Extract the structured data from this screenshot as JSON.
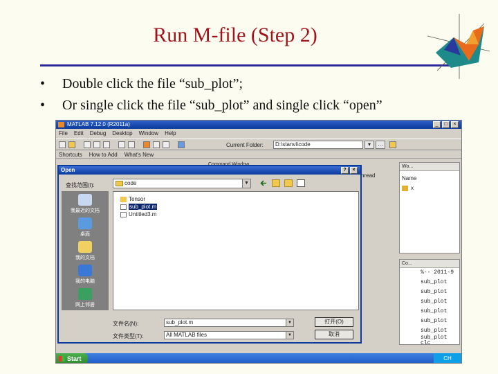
{
  "slide": {
    "title": "Run M-file (Step 2)",
    "bullets": [
      "Double click the file “sub_plot”;",
      "Or single click the file “sub_plot” and single click “open”"
    ],
    "bullet_mark": "•"
  },
  "matlab": {
    "window_title": "MATLAB 7.12.0 (R2011a)",
    "menu": [
      "File",
      "Edit",
      "Debug",
      "Desktop",
      "Window",
      "Help"
    ],
    "current_folder_label": "Current Folder:",
    "current_folder_value": "D:\\stanvi\\code",
    "shortcuts": [
      "Shortcuts",
      "How to Add",
      "What's New"
    ],
    "command_window_label": "Command Window",
    "command_text": "cnread",
    "workspace_label": "Wo...",
    "workspace_name_col": "Name",
    "workspace_var": "x",
    "history_label": "Co...",
    "history_items": [
      "%-- 2011-9",
      "sub_plot",
      "sub_plot",
      "sub_plot",
      "sub_plot",
      "sub_plot",
      "sub_plot",
      "sub_plot",
      "clc"
    ],
    "taskbar_start": "Start",
    "tray_text": "CH"
  },
  "dialog": {
    "title": "Open",
    "look_in_label": "查找范围(I):",
    "look_in_value": "code",
    "places": [
      "我最近的文档",
      "桌面",
      "我的文档",
      "我的电脑",
      "网上邻居"
    ],
    "files": [
      {
        "name": "Tensor",
        "kind": "folder",
        "selected": false
      },
      {
        "name": "sub_plot.m",
        "kind": "mfile",
        "selected": true
      },
      {
        "name": "Untitled3.m",
        "kind": "mfile",
        "selected": false
      }
    ],
    "filename_label": "文件名(N):",
    "filename_value": "sub_plot.m",
    "filetype_label": "文件类型(T):",
    "filetype_value": "All MATLAB files",
    "open_button": "打开(O)",
    "cancel_button": "取消"
  },
  "icons": {
    "folder_color": "#f0c850",
    "accent_title": "#a0151c",
    "rule_color": "#2a2a9c"
  }
}
